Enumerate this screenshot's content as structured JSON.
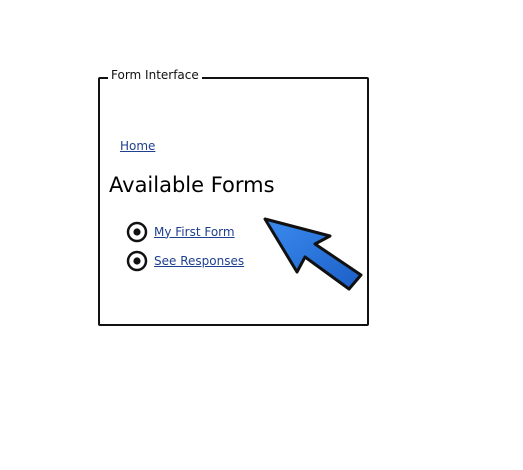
{
  "group": {
    "title": "Form Interface"
  },
  "nav": {
    "home_label": "Home"
  },
  "main": {
    "heading": "Available Forms",
    "forms": [
      {
        "label": "My First Form"
      },
      {
        "label": "See Responses"
      }
    ]
  },
  "colors": {
    "link": "#1f3f8f",
    "arrow_fill": "#2b78e4",
    "arrow_stroke": "#111111"
  },
  "icons": {
    "bullet": "radio-bullet-icon",
    "pointer": "pointer-arrow-icon"
  }
}
